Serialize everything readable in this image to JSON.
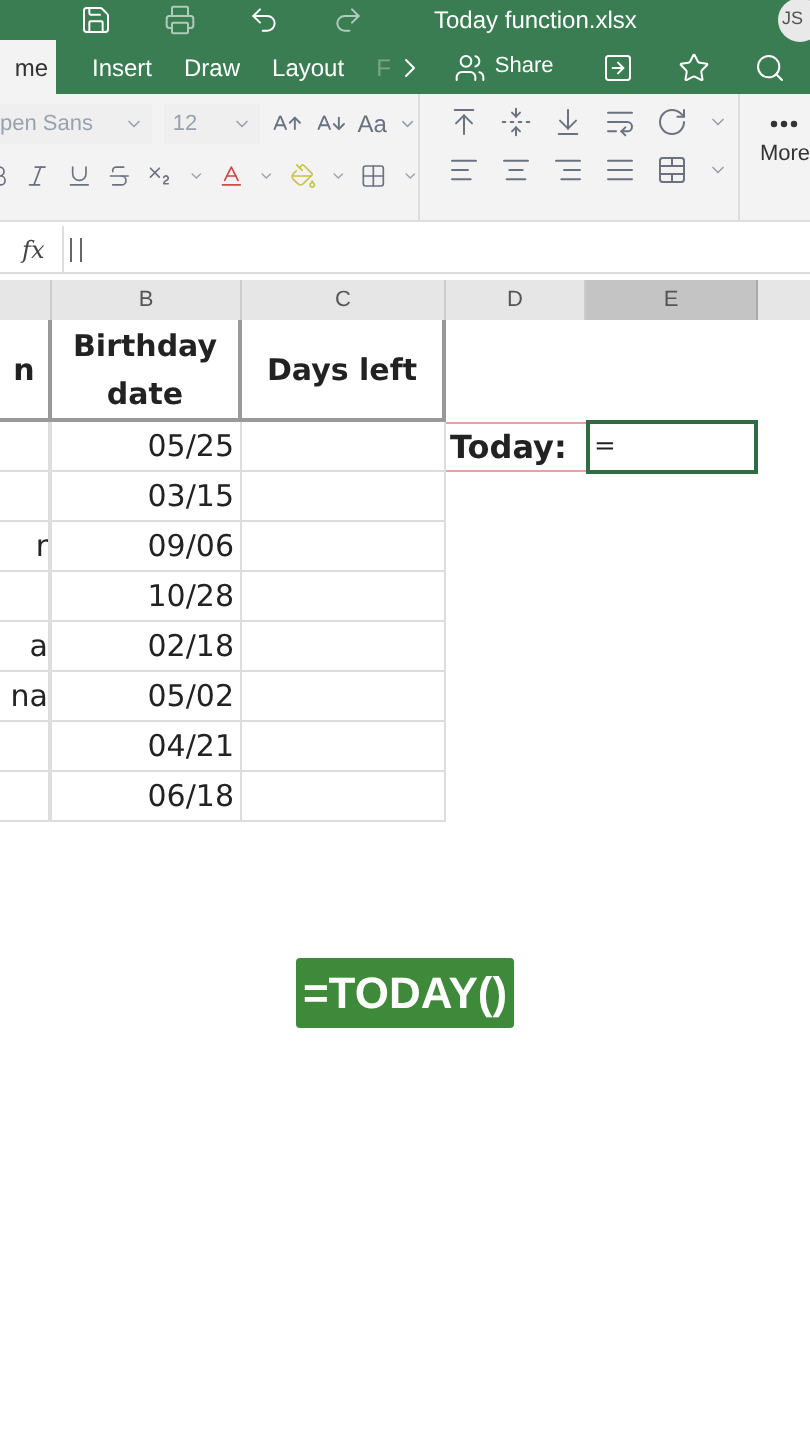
{
  "title_bar": {
    "title": "Today function.xlsx",
    "avatar": "JS"
  },
  "tabs": [
    {
      "label": "me",
      "selected": true
    },
    {
      "label": "Insert",
      "selected": false
    },
    {
      "label": "Draw",
      "selected": false
    },
    {
      "label": "Layout",
      "selected": false
    },
    {
      "label": "F",
      "selected": false
    }
  ],
  "share": "Share",
  "ribbon": {
    "font_name": "pen Sans",
    "font_size": "12",
    "case_label": "Aa",
    "more": "More"
  },
  "formula_bar": {
    "fx": "fx"
  },
  "columns": [
    {
      "label": "B",
      "selected": false
    },
    {
      "label": "C",
      "selected": false
    },
    {
      "label": "D",
      "selected": false
    },
    {
      "label": "E",
      "selected": true
    }
  ],
  "header_row": [
    "n",
    "Birthday date",
    "Days left"
  ],
  "rows": [
    {
      "date": "05/25"
    },
    {
      "date": "03/15"
    },
    {
      "name": "r",
      "date": "09/06"
    },
    {
      "date": "10/28"
    },
    {
      "name": "a",
      "date": "02/18"
    },
    {
      "name": "na",
      "date": "05/02"
    },
    {
      "date": "04/21"
    },
    {
      "date": "06/18"
    }
  ],
  "today": {
    "label": "Today:",
    "value": "="
  },
  "caption": "=TODAY()"
}
